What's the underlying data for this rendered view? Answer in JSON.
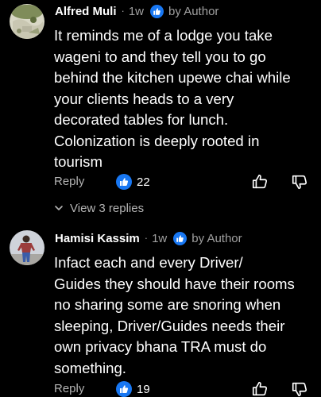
{
  "colors": {
    "background": "#000000",
    "text": "#ffffff",
    "muted": "#a0a0a0",
    "badge_blue": "#1877f2"
  },
  "comments": [
    {
      "name": "Alfred Muli",
      "separator": "·",
      "time": "1w",
      "badge_icon": "like-badge-icon",
      "author_label": "by Author",
      "text": "It reminds me of a lodge you take\nwageni to and they tell you to go\nbehind the kitchen upewe chai while\nyour clients heads to a very\ndecorated tables for lunch.\nColonization is deeply rooted in\ntourism",
      "reply_label": "Reply",
      "like_count": "22",
      "view_replies_label": "View 3 replies"
    },
    {
      "name": "Hamisi Kassim",
      "separator": "·",
      "time": "1w",
      "badge_icon": "like-badge-icon",
      "author_label": "by Author",
      "text": "Infact each and every Driver/\nGuides they should have their rooms\nno sharing some are snoring when\nsleeping, Driver/Guides needs their\nown privacy bhana TRA must do\nsomething.",
      "reply_label": "Reply",
      "like_count": "19"
    }
  ]
}
